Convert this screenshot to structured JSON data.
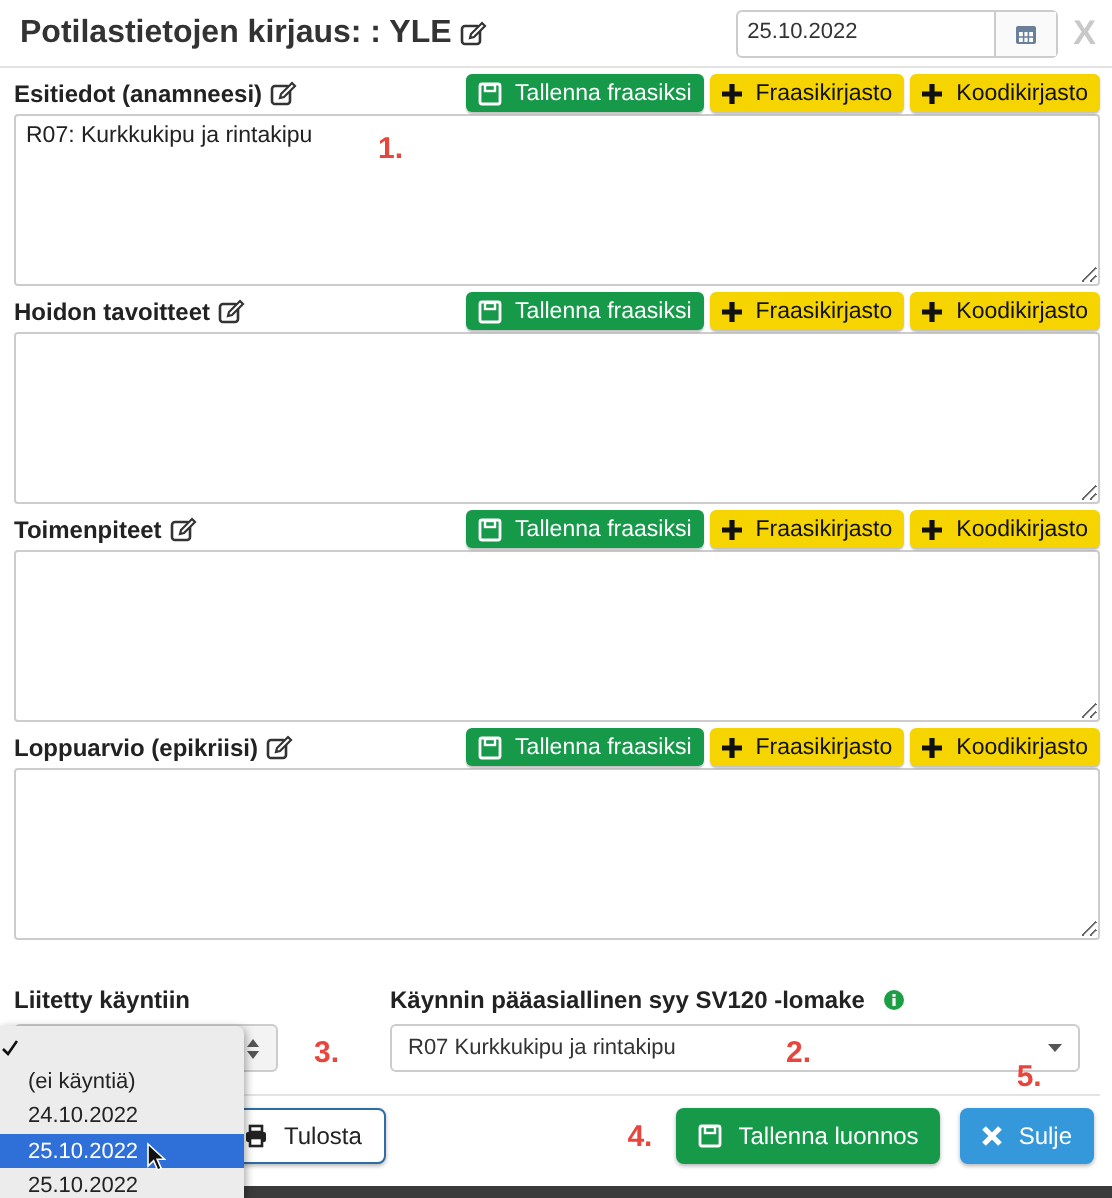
{
  "header": {
    "title": "Potilastietojen kirjaus: : YLE",
    "date": "25.10.2022",
    "close": "X"
  },
  "sections": [
    {
      "label": "Esitiedot (anamneesi)",
      "value": "R07: Kurkkukipu ja rintakipu",
      "annotation": "1.",
      "buttons": [
        {
          "kind": "save",
          "label": "Tallenna fraasiksi"
        },
        {
          "kind": "add",
          "label": "Fraasikirjasto"
        },
        {
          "kind": "add",
          "label": "Koodikirjasto"
        }
      ]
    },
    {
      "label": "Hoidon tavoitteet",
      "buttons": [
        {
          "kind": "save",
          "label": "Tallenna fraasiksi"
        },
        {
          "kind": "add",
          "label": "Fraasikirjasto"
        },
        {
          "kind": "add",
          "label": "Koodikirjasto"
        }
      ]
    },
    {
      "label": "Toimenpiteet",
      "buttons": [
        {
          "kind": "save",
          "label": "Tallenna fraasiksi"
        },
        {
          "kind": "add",
          "label": "Fraasikirjasto"
        },
        {
          "kind": "add",
          "label": "Koodikirjasto"
        }
      ]
    },
    {
      "label": "Loppuarvio (epikriisi)",
      "buttons": [
        {
          "kind": "save",
          "label": "Tallenna fraasiksi"
        },
        {
          "kind": "add",
          "label": "Fraasikirjasto"
        },
        {
          "kind": "add",
          "label": "Koodikirjasto"
        }
      ]
    }
  ],
  "visit_select": {
    "label": "Liitetty käyntiin",
    "annotation": "3.",
    "options": [
      {
        "checked": true,
        "highlighted": false
      },
      {
        "label": "(ei käyntiä)",
        "checked": false,
        "highlighted": false
      },
      {
        "label": "24.10.2022",
        "checked": false,
        "highlighted": false
      },
      {
        "label": "25.10.2022",
        "checked": false,
        "highlighted": true
      },
      {
        "label": "25.10.2022",
        "checked": false,
        "highlighted": false
      }
    ]
  },
  "reason_select": {
    "label": "Käynnin pääasiallinen syy SV120 -lomake",
    "value": "R07 Kurkkukipu ja rintakipu",
    "annotation": "2."
  },
  "footer": {
    "buttons": [
      {
        "kind": "print",
        "label": "Tulosta"
      },
      {
        "kind": "save",
        "label": "Tallenna luonnos",
        "annotation": "4."
      },
      {
        "kind": "close",
        "label": "Sulje",
        "annotation": "5."
      }
    ]
  }
}
